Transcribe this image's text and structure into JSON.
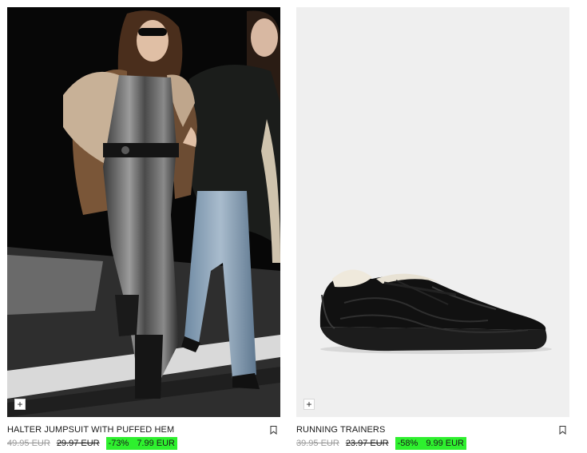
{
  "products": [
    {
      "name": "HALTER JUMPSUIT WITH PUFFED HEM",
      "original_price": "49.95 EUR",
      "previous_price": "29.97 EUR",
      "discount": "-73%",
      "sale_price": "7.99 EUR",
      "add_symbol": "+",
      "image": "model-street-photo"
    },
    {
      "name": "RUNNING TRAINERS",
      "original_price": "39.95 EUR",
      "previous_price": "23.97 EUR",
      "discount": "-58%",
      "sale_price": "9.99 EUR",
      "add_symbol": "+",
      "image": "black-sneaker"
    }
  ],
  "colors": {
    "discount_highlight": "#2ef02e",
    "strikethrough_grey": "#9a9a9a"
  },
  "icons": [
    "plus-icon",
    "bookmark-icon"
  ]
}
